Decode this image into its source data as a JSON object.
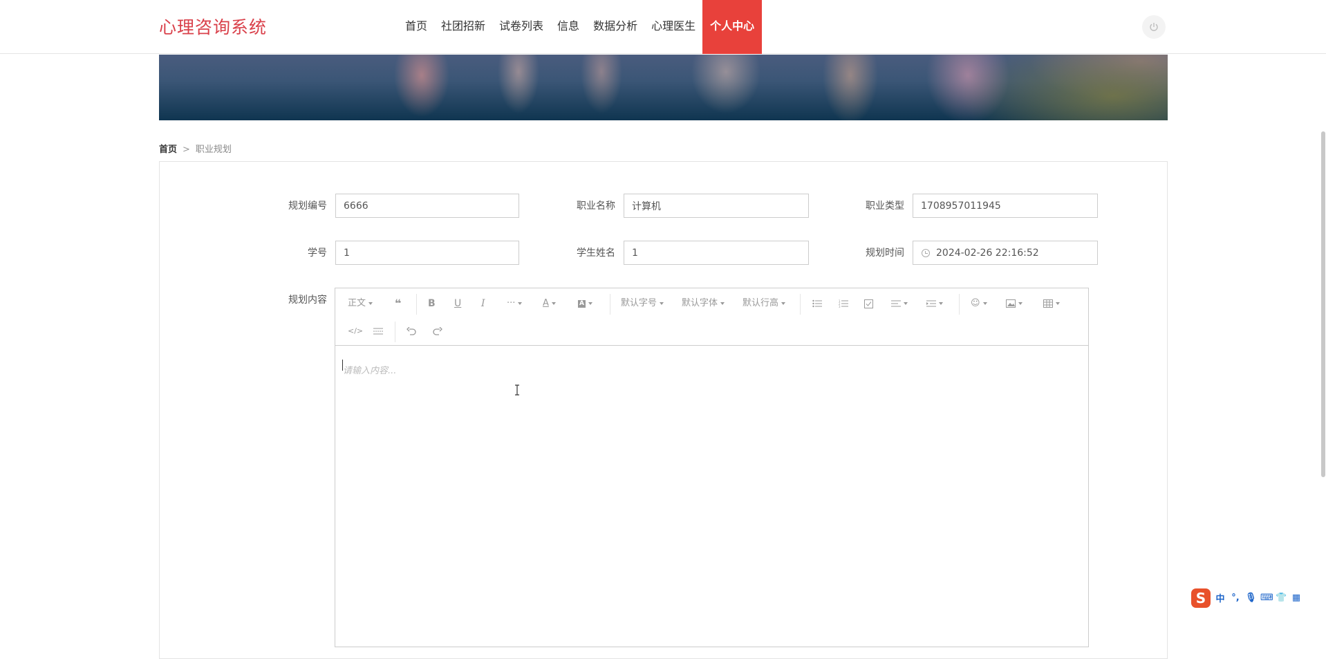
{
  "header": {
    "logo": "心理咨询系统",
    "nav": [
      "首页",
      "社团招新",
      "试卷列表",
      "信息",
      "数据分析",
      "心理医生",
      "个人中心"
    ],
    "active_nav": "个人中心"
  },
  "breadcrumb": {
    "home": "首页",
    "separator": ">",
    "current": "职业规划"
  },
  "form": {
    "plan_no": {
      "label": "规划编号",
      "value": "6666"
    },
    "career_name": {
      "label": "职业名称",
      "value": "计算机"
    },
    "career_type": {
      "label": "职业类型",
      "value": "1708957011945"
    },
    "student_no": {
      "label": "学号",
      "value": "1"
    },
    "student_name": {
      "label": "学生姓名",
      "value": "1"
    },
    "plan_time": {
      "label": "规划时间",
      "value": "2024-02-26 22:16:52"
    },
    "content": {
      "label": "规划内容",
      "placeholder": "请输入内容..."
    }
  },
  "editor_toolbar": {
    "paragraph": "正文",
    "font_size": "默认字号",
    "font_family": "默认字体",
    "line_height": "默认行高",
    "more": "···"
  },
  "ime": {
    "mode": "中",
    "punct": "°,"
  },
  "colors": {
    "accent": "#e8413b",
    "logo": "#d9404a"
  }
}
